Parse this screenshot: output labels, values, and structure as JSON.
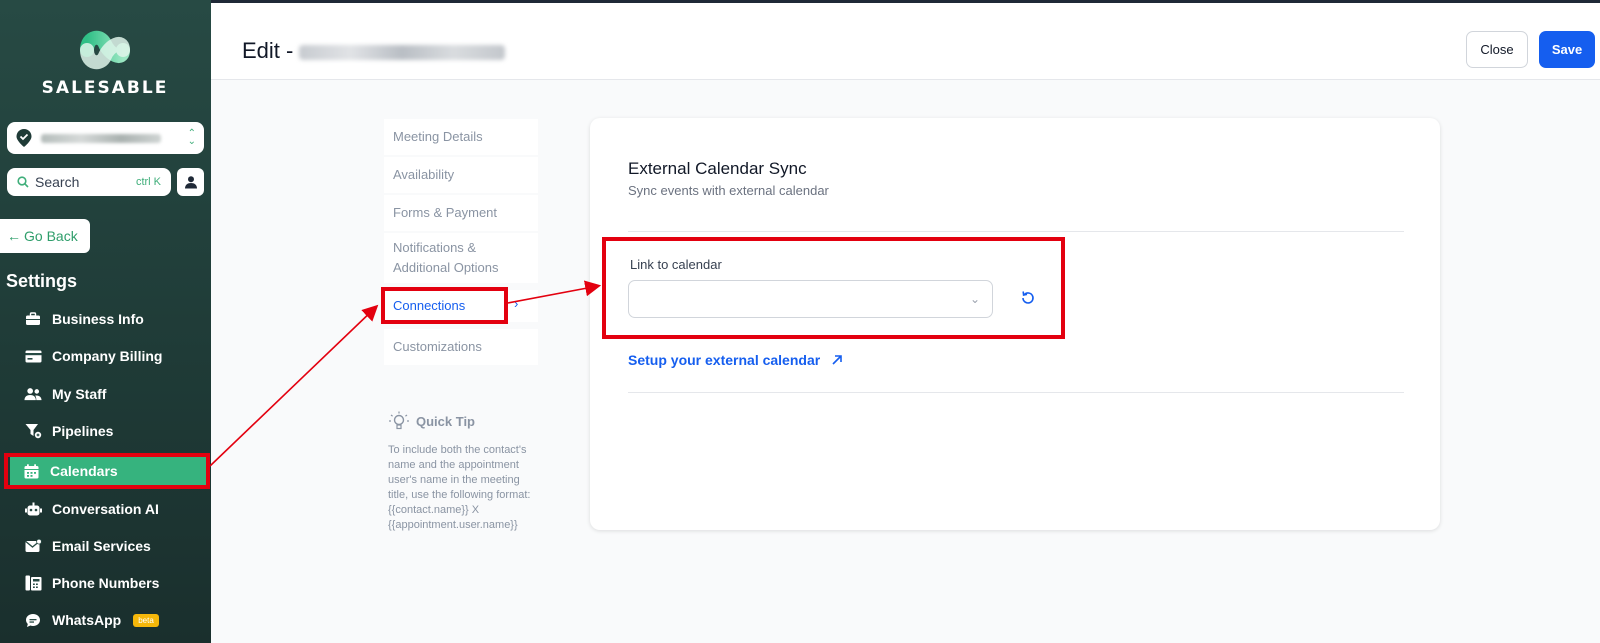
{
  "brand": {
    "name": "SALESABLE",
    "accent": "#36b37e",
    "primary": "#155eef"
  },
  "sidebar": {
    "search_label": "Search",
    "search_shortcut": "ctrl K",
    "go_back": "Go Back",
    "section_title": "Settings",
    "items": [
      {
        "label": "Business Info",
        "icon": "briefcase-icon"
      },
      {
        "label": "Company Billing",
        "icon": "credit-card-icon"
      },
      {
        "label": "My Staff",
        "icon": "users-icon"
      },
      {
        "label": "Pipelines",
        "icon": "filter-icon"
      },
      {
        "label": "Calendars",
        "icon": "calendar-icon",
        "active": true
      },
      {
        "label": "Conversation AI",
        "icon": "robot-icon"
      },
      {
        "label": "Email Services",
        "icon": "envelope-icon"
      },
      {
        "label": "Phone Numbers",
        "icon": "phone-book-icon"
      },
      {
        "label": "WhatsApp",
        "icon": "chat-icon",
        "badge": "beta"
      }
    ]
  },
  "header": {
    "title_prefix": "Edit -",
    "close_label": "Close",
    "save_label": "Save"
  },
  "subnav": {
    "items": [
      {
        "label": "Meeting Details"
      },
      {
        "label": "Availability"
      },
      {
        "label": "Forms & Payment"
      },
      {
        "label": "Notifications & Additional Options"
      },
      {
        "label": "Connections",
        "active": true
      },
      {
        "label": "Customizations"
      }
    ]
  },
  "quick_tip": {
    "title": "Quick Tip",
    "body": "To include both the contact's name and the appointment user's name in the meeting title, use the following format: {{contact.name}} X {{appointment.user.name}}"
  },
  "card": {
    "title": "External Calendar Sync",
    "subtitle": "Sync events with external calendar",
    "field_label": "Link to calendar",
    "setup_link": "Setup your external calendar"
  }
}
